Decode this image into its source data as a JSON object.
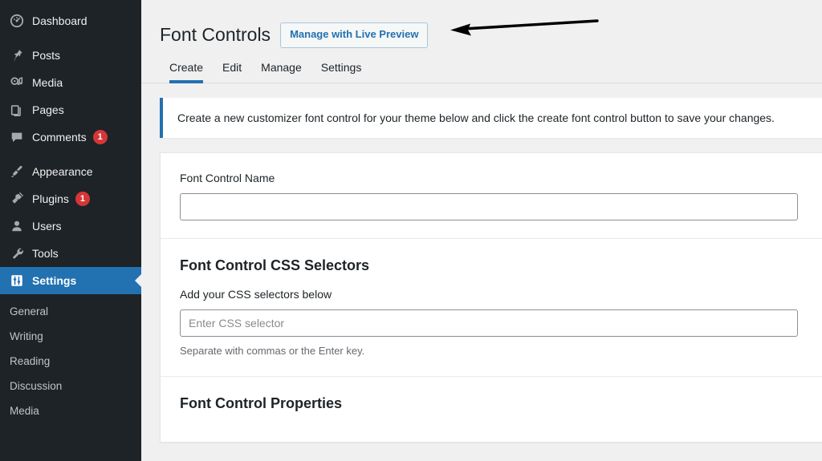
{
  "sidebar": {
    "items": [
      {
        "label": "Dashboard",
        "icon": "dashboard-icon",
        "badge": null,
        "active": false
      },
      {
        "label": "Posts",
        "icon": "pin-icon",
        "badge": null,
        "active": false
      },
      {
        "label": "Media",
        "icon": "media-icon",
        "badge": null,
        "active": false
      },
      {
        "label": "Pages",
        "icon": "pages-icon",
        "badge": null,
        "active": false
      },
      {
        "label": "Comments",
        "icon": "comment-icon",
        "badge": "1",
        "active": false
      },
      {
        "label": "Appearance",
        "icon": "paintbrush-icon",
        "badge": null,
        "active": false
      },
      {
        "label": "Plugins",
        "icon": "plug-icon",
        "badge": "1",
        "active": false
      },
      {
        "label": "Users",
        "icon": "user-icon",
        "badge": null,
        "active": false
      },
      {
        "label": "Tools",
        "icon": "wrench-icon",
        "badge": null,
        "active": false
      },
      {
        "label": "Settings",
        "icon": "settings-sliders-icon",
        "badge": null,
        "active": true
      }
    ],
    "submenu": [
      {
        "label": "General"
      },
      {
        "label": "Writing"
      },
      {
        "label": "Reading"
      },
      {
        "label": "Discussion"
      },
      {
        "label": "Media"
      }
    ],
    "colors": {
      "background": "#1d2327",
      "active_background": "#2271b1",
      "badge_background": "#d63638",
      "text": "#f0f0f1",
      "submenu_text": "#c3c4c7"
    }
  },
  "header": {
    "title": "Font Controls",
    "live_preview_label": "Manage with Live Preview"
  },
  "tabs": [
    {
      "label": "Create",
      "active": true
    },
    {
      "label": "Edit",
      "active": false
    },
    {
      "label": "Manage",
      "active": false
    },
    {
      "label": "Settings",
      "active": false
    }
  ],
  "notice": {
    "text": "Create a new customizer font control for your theme below and click the create font control button to save your changes.",
    "accent_color": "#2271b1"
  },
  "form": {
    "name_section": {
      "label": "Font Control Name",
      "value": "",
      "placeholder": ""
    },
    "selectors_section": {
      "heading": "Font Control CSS Selectors",
      "label": "Add your CSS selectors below",
      "value": "",
      "placeholder": "Enter CSS selector",
      "help": "Separate with commas or the Enter key."
    },
    "properties_section": {
      "heading": "Font Control Properties"
    }
  },
  "annotation": {
    "type": "arrow",
    "direction": "left",
    "color": "#000000"
  }
}
